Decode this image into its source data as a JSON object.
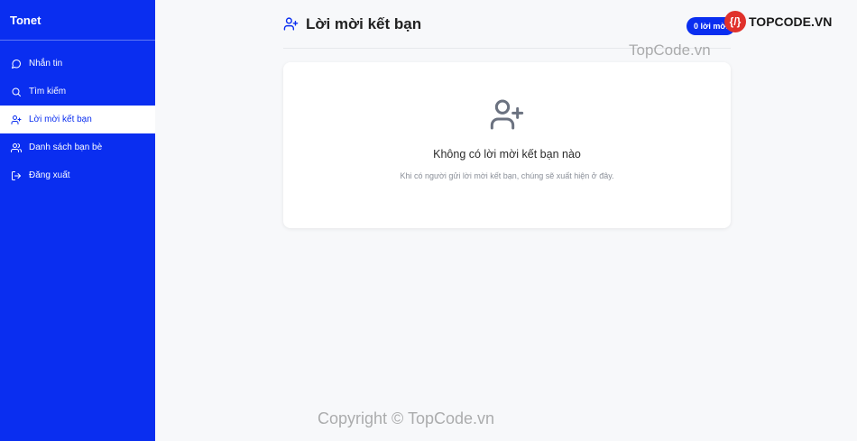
{
  "app": {
    "brand": "Tonet"
  },
  "sidebar": {
    "items": [
      {
        "label": "Nhắn tin",
        "icon": "chat-bubble-icon",
        "active": false
      },
      {
        "label": "Tìm kiếm",
        "icon": "search-icon",
        "active": false
      },
      {
        "label": "Lời mời kết bạn",
        "icon": "user-plus-icon",
        "active": true
      },
      {
        "label": "Danh sách bạn bè",
        "icon": "users-icon",
        "active": false
      },
      {
        "label": "Đăng xuất",
        "icon": "logout-icon",
        "active": false
      }
    ]
  },
  "header": {
    "title": "Lời mời kết bạn",
    "icon": "user-plus-icon"
  },
  "badge": {
    "label": "0 lời mời"
  },
  "empty_state": {
    "icon": "user-plus-icon",
    "title": "Không có lời mời kết bạn nào",
    "description": "Khi có người gửi lời mời kết bạn, chúng sẽ xuất hiện ở đây."
  },
  "watermarks": {
    "logo_mark": "{/}",
    "logo_text": "TOPCODE.VN",
    "top": "TopCode.vn",
    "bottom": "Copyright © TopCode.vn"
  },
  "colors": {
    "primary": "#0a2ef0",
    "background": "#f7f8fa",
    "card": "#ffffff"
  }
}
